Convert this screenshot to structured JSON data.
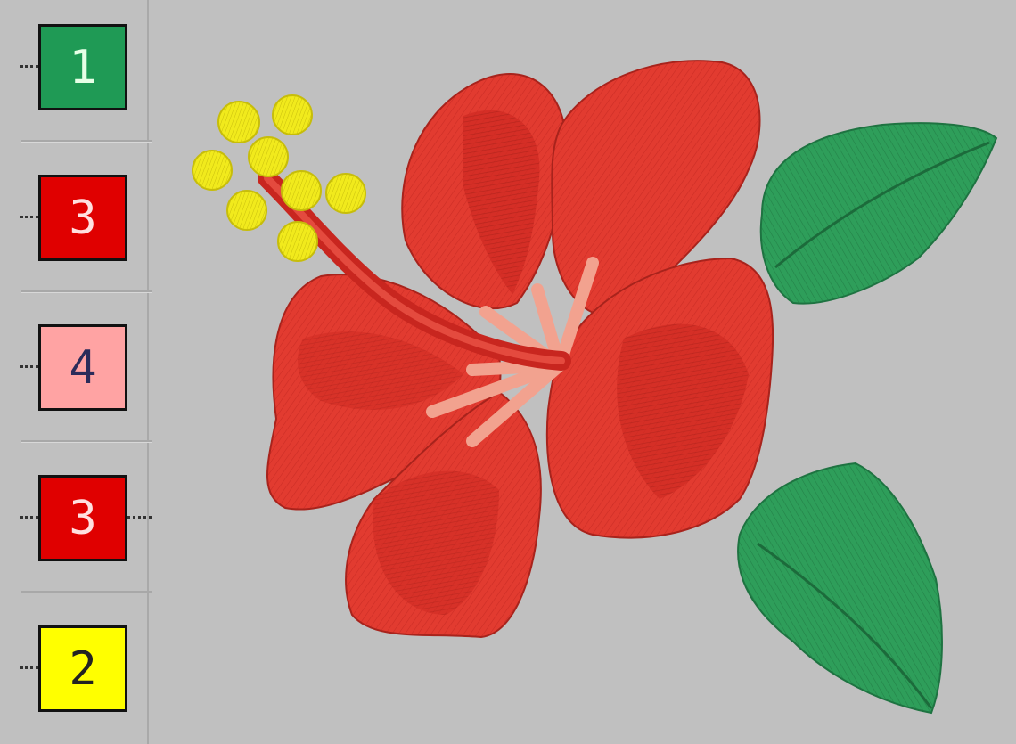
{
  "sequence": [
    {
      "number": "1",
      "color": "#1f9a55",
      "text_color": "#e6ffe6"
    },
    {
      "number": "3",
      "color": "#e00000",
      "text_color": "#ffe0e0"
    },
    {
      "number": "4",
      "color": "#ffa3a3",
      "text_color": "#2b2b5a"
    },
    {
      "number": "3",
      "color": "#e00000",
      "text_color": "#ffe0e0"
    },
    {
      "number": "2",
      "color": "#ffff00",
      "text_color": "#222222"
    }
  ],
  "thread_colors": {
    "green": "#2e9e5a",
    "red": "#e23b30",
    "pink": "#f2a28f",
    "yellow": "#f1ea1c"
  }
}
